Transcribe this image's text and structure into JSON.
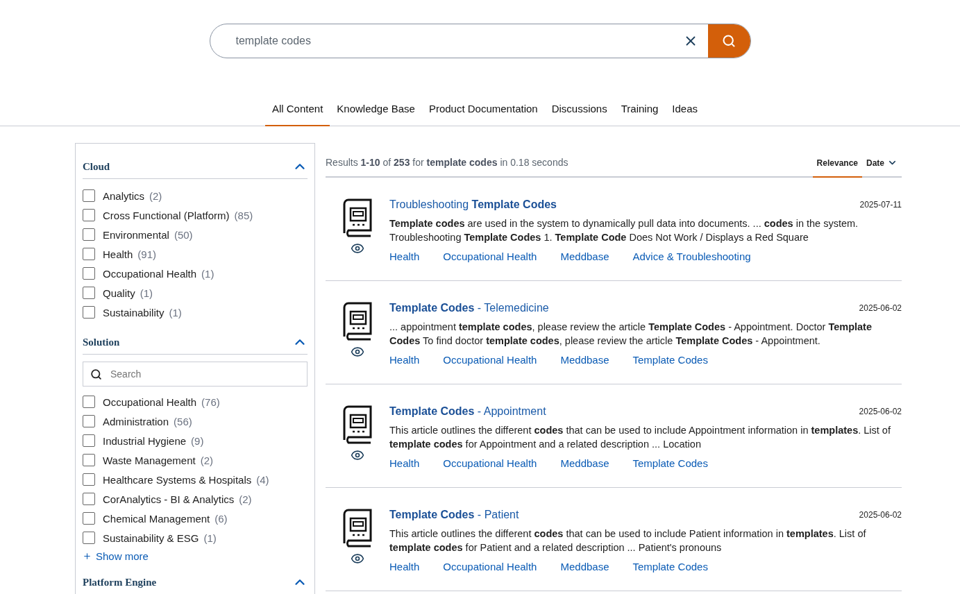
{
  "search": {
    "value": "template codes"
  },
  "tabs": [
    {
      "label": "All Content",
      "selected": true
    },
    {
      "label": "Knowledge Base",
      "selected": false
    },
    {
      "label": "Product Documentation",
      "selected": false
    },
    {
      "label": "Discussions",
      "selected": false
    },
    {
      "label": "Training",
      "selected": false
    },
    {
      "label": "Ideas",
      "selected": false
    }
  ],
  "sidebar": {
    "sections": [
      {
        "title": "Cloud",
        "expanded": true,
        "items": [
          {
            "label": "Analytics",
            "count": "(2)",
            "checked": false
          },
          {
            "label": "Cross Functional (Platform)",
            "count": "(85)",
            "checked": false
          },
          {
            "label": "Environmental",
            "count": "(50)",
            "checked": false
          },
          {
            "label": "Health",
            "count": "(91)",
            "checked": false
          },
          {
            "label": "Occupational Health",
            "count": "(1)",
            "checked": false
          },
          {
            "label": "Quality",
            "count": "(1)",
            "checked": false
          },
          {
            "label": "Sustainability",
            "count": "(1)",
            "checked": false
          }
        ]
      },
      {
        "title": "Solution",
        "expanded": true,
        "search_placeholder": "Search",
        "items": [
          {
            "label": "Occupational Health",
            "count": "(76)",
            "checked": false
          },
          {
            "label": "Administration",
            "count": "(56)",
            "checked": false
          },
          {
            "label": "Industrial Hygiene",
            "count": "(9)",
            "checked": false
          },
          {
            "label": "Waste Management",
            "count": "(2)",
            "checked": false
          },
          {
            "label": "Healthcare Systems & Hospitals",
            "count": "(4)",
            "checked": false
          },
          {
            "label": "CorAnalytics - BI & Analytics",
            "count": "(2)",
            "checked": false
          },
          {
            "label": "Chemical Management",
            "count": "(6)",
            "checked": false
          },
          {
            "label": "Sustainability & ESG",
            "count": "(1)",
            "checked": false
          }
        ],
        "show_more": "Show more"
      },
      {
        "title": "Platform Engine",
        "expanded": true
      }
    ]
  },
  "results_summary": "Results **1-10** of **253** for **template codes** in 0.18 seconds",
  "sort": [
    {
      "label": "Relevance",
      "selected": true
    },
    {
      "label": "Date",
      "selected": false
    }
  ],
  "results": [
    {
      "title": "Troubleshooting **Template Codes**",
      "date": "2025-07-11",
      "snippet": "**Template codes** are used in the system to dynamically pull data into documents. ... **codes** in the system. Troubleshooting **Template Codes** 1. **Template Code** Does Not Work / Displays a Red Square",
      "tags": [
        "Health",
        "Occupational Health",
        "Meddbase",
        "Advice & Troubleshooting"
      ]
    },
    {
      "title": "**Template Codes** - Telemedicine",
      "date": "2025-06-02",
      "snippet": "... appointment **template codes**, please review the article **Template Codes** - Appointment. Doctor **Template Codes** To find doctor **template codes**, please review the article **Template Codes** - Appointment.",
      "tags": [
        "Health",
        "Occupational Health",
        "Meddbase",
        "Template Codes"
      ]
    },
    {
      "title": "**Template Codes** - Appointment",
      "date": "2025-06-02",
      "snippet": "This article outlines the different **codes** that can be used to include Appointment information in **templates**. List of **template codes** for Appointment and a related description ... Location",
      "tags": [
        "Health",
        "Occupational Health",
        "Meddbase",
        "Template Codes"
      ]
    },
    {
      "title": "**Template Codes** - Patient",
      "date": "2025-06-02",
      "snippet": "This article outlines the different **codes** that can be used to include Patient information in **templates**. List of **template codes** for Patient and a related description ... Patient's pronouns",
      "tags": [
        "Health",
        "Occupational Health",
        "Meddbase",
        "Template Codes"
      ]
    }
  ]
}
